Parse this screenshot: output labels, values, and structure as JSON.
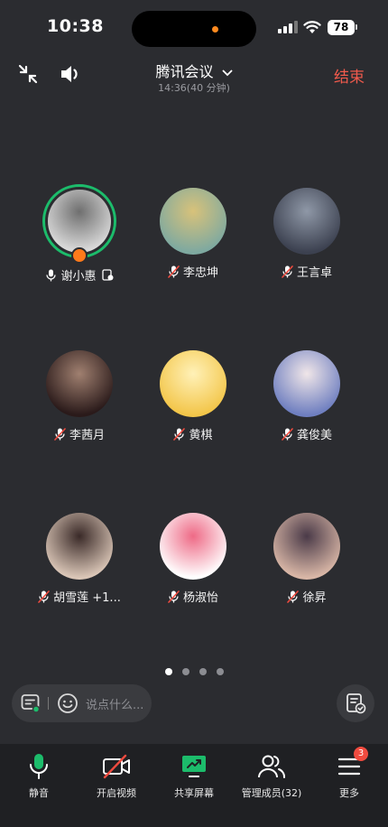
{
  "status_bar": {
    "time": "10:38",
    "battery": "78"
  },
  "header": {
    "title": "腾讯会议",
    "subtitle": "14:36(40 分钟)",
    "end_label": "结束"
  },
  "participants": [
    {
      "name": "谢小惠",
      "host": true,
      "mic": "on",
      "sharing": true,
      "avatar_colors": [
        "#d9d9d9",
        "#6f6f6f"
      ]
    },
    {
      "name": "李忠坤",
      "host": false,
      "mic": "muted",
      "avatar_colors": [
        "#7ea9a0",
        "#d8c27a"
      ]
    },
    {
      "name": "王言卓",
      "host": false,
      "mic": "muted",
      "avatar_colors": [
        "#3c4150",
        "#8f98a7"
      ]
    },
    {
      "name": "李茜月",
      "host": false,
      "mic": "muted",
      "avatar_colors": [
        "#2a1a1a",
        "#a08070"
      ]
    },
    {
      "name": "黄棋",
      "host": false,
      "mic": "muted",
      "avatar_colors": [
        "#f3c64a",
        "#fff1b8"
      ]
    },
    {
      "name": "龚俊美",
      "host": false,
      "mic": "muted",
      "avatar_colors": [
        "#6f7fc0",
        "#f0e6e8"
      ]
    },
    {
      "name": "胡雪莲 +1...",
      "host": false,
      "mic": "muted",
      "avatar_colors": [
        "#d9c5b6",
        "#3a2a28"
      ]
    },
    {
      "name": "杨淑怡",
      "host": false,
      "mic": "muted",
      "avatar_colors": [
        "#ffffff",
        "#ee6a86"
      ]
    },
    {
      "name": "徐昇",
      "host": false,
      "mic": "muted",
      "avatar_colors": [
        "#d8b6a6",
        "#4a3a48"
      ]
    }
  ],
  "pager": {
    "pages": 4,
    "current": 1
  },
  "chat": {
    "placeholder": "说点什么..."
  },
  "toolbar": {
    "mute_label": "静音",
    "video_label": "开启视频",
    "share_label": "共享屏幕",
    "members_label": "管理成员(32)",
    "more_label": "更多",
    "more_badge": "3"
  },
  "colors": {
    "background": "#2b2c30",
    "toolbar": "#1f2023",
    "accent_green": "#1cbc6b",
    "danger": "#f05a4c",
    "host_orange": "#ff7a1b"
  }
}
